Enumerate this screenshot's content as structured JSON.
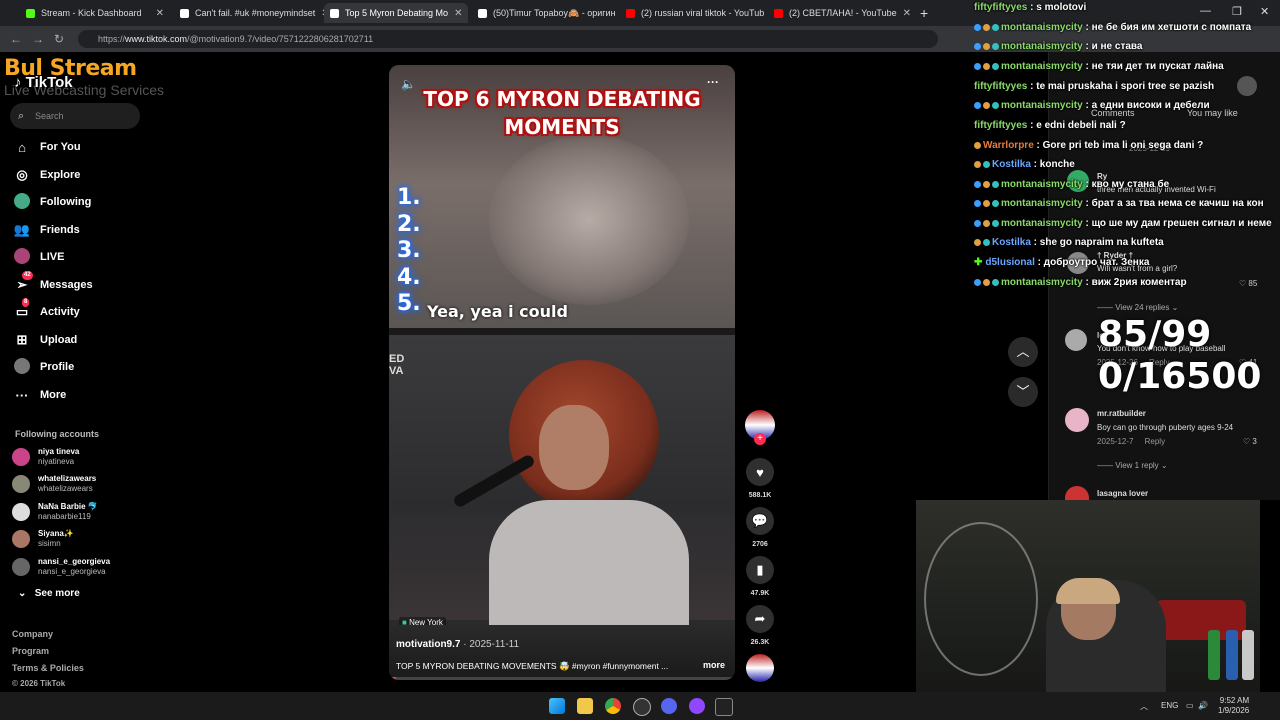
{
  "browser": {
    "tabs": [
      {
        "label": "Stream - Kick Dashboard",
        "color": "#53fc18"
      },
      {
        "label": "Can't fail. #uk #moneymindset",
        "color": "#ffffff"
      },
      {
        "label": "Top 5 Myron Debating Mo",
        "color": "#ffffff"
      },
      {
        "label": "(50)Timur Topaboy🙈 - оригин",
        "color": "#ffffff"
      },
      {
        "label": "(2) russian viral tiktok - YouTub",
        "color": "#ff0000"
      },
      {
        "label": "(2) СВЕТЛАНА! - YouTube",
        "color": "#ff0000"
      }
    ],
    "url_prefix": "https://",
    "url_host": "www.tiktok.com",
    "url_path": "/@motivation9.7/video/7571222806281702711"
  },
  "overlay_logo": {
    "brand": "Bul Stream",
    "sub": "Live Webcasting Services"
  },
  "tiktok": {
    "logo": "TikTok",
    "search_placeholder": "Search",
    "nav": [
      {
        "label": "For You",
        "icon": "home-icon"
      },
      {
        "label": "Explore",
        "icon": "compass-icon"
      },
      {
        "label": "Following",
        "icon": "following-icon"
      },
      {
        "label": "Friends",
        "icon": "friends-icon"
      },
      {
        "label": "LIVE",
        "icon": "live-icon"
      },
      {
        "label": "Messages",
        "icon": "messages-icon",
        "badge": "42"
      },
      {
        "label": "Activity",
        "icon": "activity-icon",
        "badge": "8"
      },
      {
        "label": "Upload",
        "icon": "upload-icon"
      },
      {
        "label": "Profile",
        "icon": "profile-icon"
      },
      {
        "label": "More",
        "icon": "more-icon"
      }
    ],
    "following_title": "Following accounts",
    "following": [
      {
        "name": "niya tineva",
        "handle": "niyatineva"
      },
      {
        "name": "whatelizawears",
        "handle": "whatelizawears"
      },
      {
        "name": "NaNa Barbie 🐬",
        "handle": "nanabarbie119"
      },
      {
        "name": "Siyana✨",
        "handle": "sisimn"
      },
      {
        "name": "nansi_e_georgieva",
        "handle": "nansi_e_georgieva"
      }
    ],
    "see_more": "See more",
    "footer": [
      "Company",
      "Program",
      "Terms & Policies",
      "© 2026 TikTok"
    ]
  },
  "video": {
    "title_line1": "TOP 6 MYRON DEBATING",
    "title_line2": "MOMENTS",
    "numbers": [
      "1.",
      "2.",
      "3.",
      "4.",
      "5."
    ],
    "caption": "Yea, yea i could",
    "side_watermark": "ED\nVA",
    "location": "New York",
    "author": "motivation9.7",
    "date": "· 2025-11-11",
    "description": "TOP 5 MYRON DEBATING MOVEMENTS 🤯 #myron #funnymoment ...",
    "more_label": "more",
    "progress": 0.02
  },
  "rail": {
    "likes": "588.1K",
    "comments": "2706",
    "saves": "47.9K",
    "shares": "26.3K"
  },
  "comments_panel": {
    "tabs": [
      "Comments",
      "You may like"
    ],
    "items": [
      {
        "name": "Ry",
        "text": "three men actually invented Wi-Fi"
      },
      {
        "name": "† Ryder †",
        "text": "Wifi wasn't from a girl?",
        "likes": "85"
      },
      {
        "view_replies": "View 24 replies"
      },
      {
        "name": "lo",
        "text": "You don't know how to play baseball",
        "date": "2025-12-26",
        "reply": "Reply",
        "likes": "41"
      },
      {
        "name": "mr.ratbuilder",
        "text": "Boy can go through puberty ages 9-24",
        "date": "2025-12-7",
        "reply": "Reply",
        "likes": "3"
      },
      {
        "view_replies": "View 1 reply"
      },
      {
        "name": "lasagna lover"
      }
    ],
    "background_dates": [
      "2025-12-29",
      "2025-12-26"
    ]
  },
  "chat": [
    {
      "user": "fiftyfiftyyes",
      "msg": "s molotovi",
      "color": "#8ad96b"
    },
    {
      "user": "montanaismycity",
      "msg": "не бе бия им хетшоти с помпата",
      "color": "#8ad96b"
    },
    {
      "user": "montanaismycity",
      "msg": "и не става",
      "color": "#8ad96b"
    },
    {
      "user": "montanaismycity",
      "msg": "не тяи дет ти пускат лайна",
      "color": "#8ad96b"
    },
    {
      "user": "fiftyfiftyyes",
      "msg": "te mai pruskaha i spori tree se pazish",
      "color": "#8ad96b"
    },
    {
      "user": "montanaismycity",
      "msg": "а едни високи и дебели",
      "color": "#8ad96b"
    },
    {
      "user": "fiftyfiftyyes",
      "msg": "e edni debeli nali ?",
      "color": "#8ad96b"
    },
    {
      "user": "Warrlorpre",
      "msg": "Gore pri teb ima li oni sega dani ?",
      "color": "#e87a3e"
    },
    {
      "user": "Kostilka",
      "msg": "konche",
      "color": "#6aa7ff"
    },
    {
      "user": "montanaismycity",
      "msg": "кво му стана бе",
      "color": "#8ad96b"
    },
    {
      "user": "montanaismycity",
      "msg": "брат а за тва нема се качиш на кон",
      "color": "#8ad96b"
    },
    {
      "user": "montanaismycity",
      "msg": "що ше му дам грешен сигнал и неме",
      "color": "#8ad96b"
    },
    {
      "user": "Kostilka",
      "msg": "she go napraim na kufteta",
      "color": "#6aa7ff"
    },
    {
      "user": "d5lusional",
      "msg": "доброутро чат. Зенка",
      "color": "#6aa7ff"
    },
    {
      "user": "montanaismycity",
      "msg": "виж 2рия коментар",
      "color": "#8ad96b"
    }
  ],
  "counter": {
    "line1": "85/99",
    "line2": "0/16500"
  },
  "taskbar": {
    "lang": "ENG",
    "time": "9:52 AM",
    "date": "1/9/2026"
  }
}
